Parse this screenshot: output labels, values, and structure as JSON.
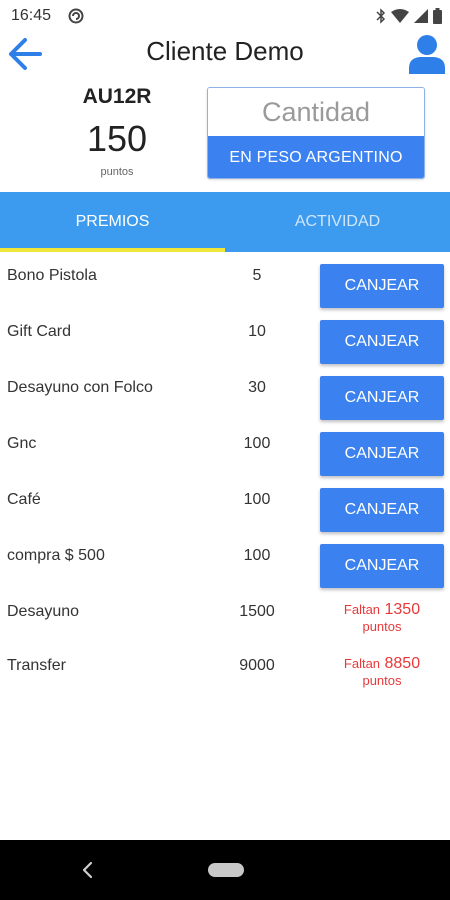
{
  "status_bar": {
    "time": "16:45",
    "icons": [
      "app-notification-icon",
      "bluetooth-icon",
      "wifi-icon",
      "signal-icon",
      "battery-icon"
    ]
  },
  "header": {
    "title": "Cliente Demo",
    "back_icon": "arrow-left-icon",
    "profile_icon": "user-profile-icon"
  },
  "client": {
    "code": "AU12R",
    "points": "150",
    "points_label": "puntos"
  },
  "quantity": {
    "placeholder": "Cantidad",
    "value": "",
    "currency_button": "EN PESO ARGENTINO"
  },
  "tabs": [
    {
      "label": "PREMIOS",
      "selected": true
    },
    {
      "label": "ACTIVIDAD",
      "selected": false
    }
  ],
  "rewards": [
    {
      "name": "Bono Pistola",
      "points": "5",
      "action": "CANJEAR"
    },
    {
      "name": "Gift Card",
      "points": "10",
      "action": "CANJEAR"
    },
    {
      "name": "Desayuno con Folco",
      "points": "30",
      "action": "CANJEAR"
    },
    {
      "name": "Gnc",
      "points": "100",
      "action": "CANJEAR"
    },
    {
      "name": "Café",
      "points": "100",
      "action": "CANJEAR"
    },
    {
      "name": "compra $ 500",
      "points": "100",
      "action": "CANJEAR"
    },
    {
      "name": "Desayuno",
      "points": "1500",
      "missing_prefix": "Faltan",
      "missing_points": "1350",
      "missing_suffix": "puntos"
    },
    {
      "name": "Transfer",
      "points": "9000",
      "missing_prefix": "Faltan",
      "missing_points": "8850",
      "missing_suffix": "puntos"
    }
  ],
  "colors": {
    "primary": "#3b82f0",
    "tab_bar": "#3d9bef",
    "tab_indicator": "#f2e63b",
    "missing_text": "#e8393a"
  }
}
